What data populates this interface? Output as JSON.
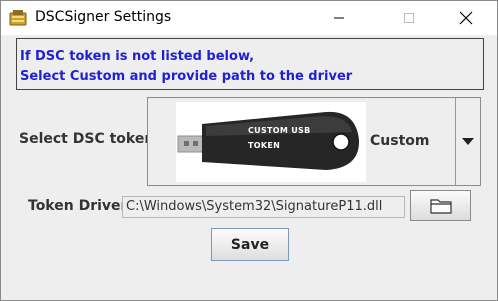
{
  "window": {
    "title": "DSCSigner Settings",
    "icon": "app-icon",
    "controls": [
      "minimize-icon",
      "maximize-icon",
      "close-icon"
    ]
  },
  "info": {
    "line1": "If DSC token is not listed below,",
    "line2": "Select Custom and provide path to the driver",
    "color": "#1f1fd8"
  },
  "token_select": {
    "label": "Select DSC token",
    "selected_value": "Custom",
    "image_text_line1": "CUSTOM USB",
    "image_text_line2": "TOKEN",
    "arrow_icon": "triangle-down-icon"
  },
  "driver": {
    "label": "Token Driver",
    "value": "C:\\Windows\\System32\\SignatureP11.dll",
    "browse_icon": "folder-icon"
  },
  "save_label": "Save"
}
